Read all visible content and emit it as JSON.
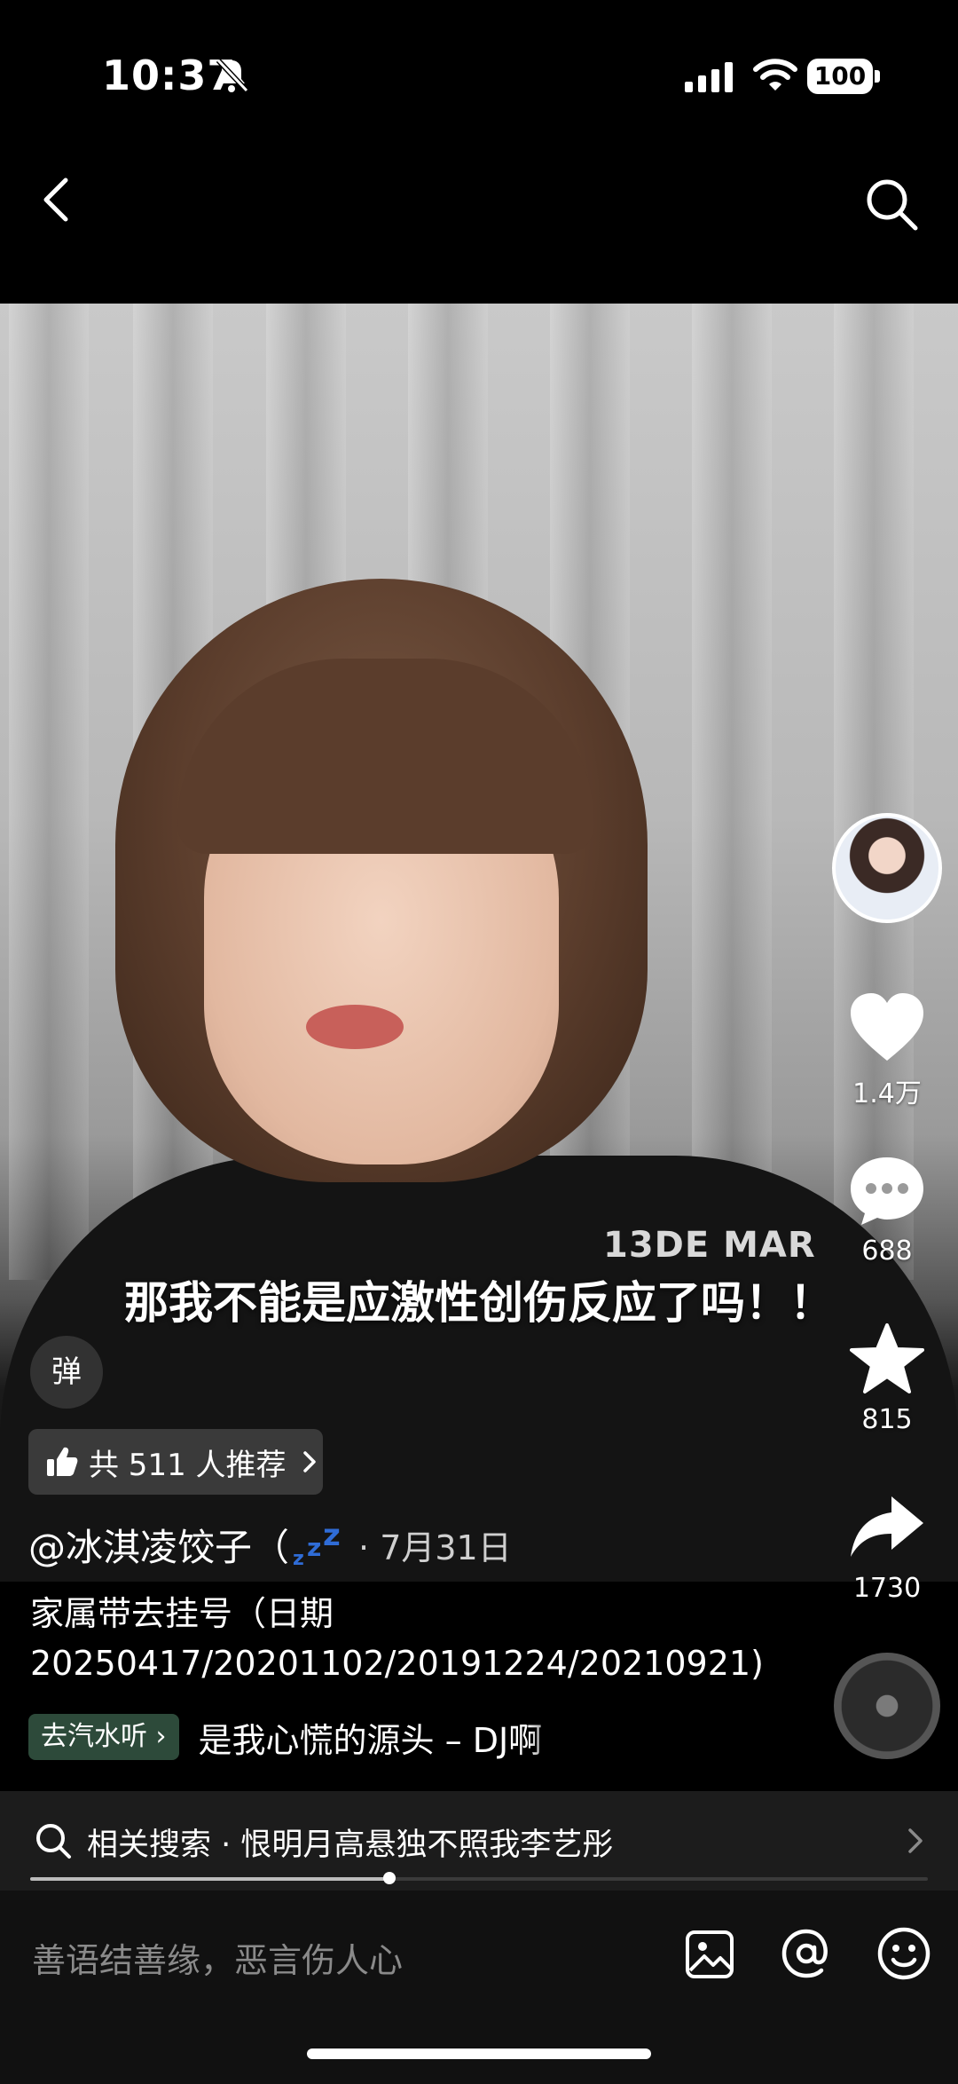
{
  "status_bar": {
    "time": "10:37",
    "battery": "100"
  },
  "video": {
    "subtitle": "那我不能是应激性创伤反应了吗！！",
    "shirt_print": "13DE MAR"
  },
  "rail": {
    "likes": "1.4万",
    "comments": "688",
    "favorites": "815",
    "shares": "1730"
  },
  "danmaku": {
    "label": "弹"
  },
  "recommend": {
    "label": "共 511 人推荐"
  },
  "author": {
    "name": "@冰淇凌饺子（",
    "separator": "·",
    "date": "7月31日"
  },
  "description": {
    "line1": "家属带去挂号（日期",
    "line2": "20250417/20201102/20191224/20210921)"
  },
  "music": {
    "button_label": "去汽水听",
    "title": "是我心慌的源头 – DJ啊"
  },
  "related_search": {
    "label": "相关搜索 · 恨明月高悬独不照我李艺彤"
  },
  "progress": {
    "fraction": 0.4
  },
  "comment_bar": {
    "placeholder": "善语结善缘，恶言伤人心"
  },
  "colors": {
    "background": "#000000",
    "music_pill": "#2d4a3a",
    "sleep_icon": "#2f6cd6"
  }
}
